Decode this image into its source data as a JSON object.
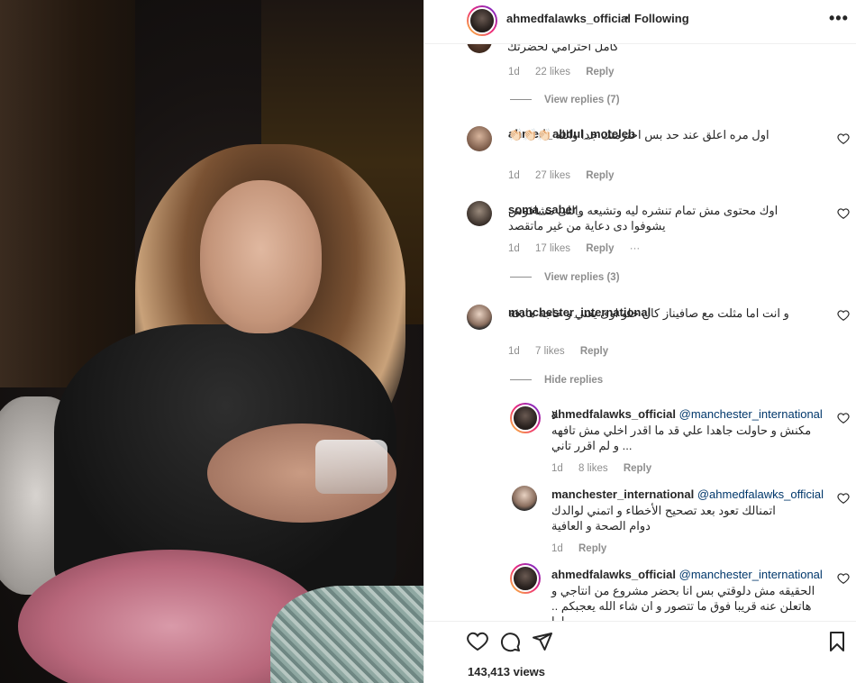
{
  "header": {
    "username": "ahmedfalawks_official",
    "separator": "•",
    "follow_status": "Following",
    "more": "•••"
  },
  "comments": [
    {
      "text": "كامل احترامي لحضرتك",
      "time": "1d",
      "likes": "22 likes",
      "reply": "Reply",
      "view_replies": "View replies (7)"
    },
    {
      "username": "ahmed_abdul_moteleb",
      "text": "اول مره اعلق عند حد بس احترمتك جدا والله 👏🏻👏🏻👏🏻",
      "time": "1d",
      "likes": "27 likes",
      "reply": "Reply"
    },
    {
      "username": "soma_saber_",
      "text": "اوك محتوى مش تمام تنشره ليه وتشيعه واللى مشافوش يشوفوا دى دعاية من غير ماتقصد",
      "time": "1d",
      "likes": "17 likes",
      "reply": "Reply",
      "more": "···",
      "view_replies": "View replies (3)"
    },
    {
      "username": "manchester_international",
      "text": "و انت اما مثلت مع صافيناز كان حلو اوى يعني و حاجة هادفة",
      "time": "1d",
      "likes": "7 likes",
      "reply": "Reply",
      "hide_replies": "Hide replies"
    }
  ],
  "replies": [
    {
      "username": "ahmedfalawks_official",
      "mention": "@manchester_international",
      "text_lead": "لا",
      "text": "مكنش و حاولت جاهدا علي قد ما اقدر اخلي مش تافهه ... و لم اقرر تاني",
      "time": "1d",
      "likes": "8 likes",
      "reply": "Reply"
    },
    {
      "username": "manchester_international",
      "mention": "@ahmedfalawks_official",
      "text": "اتمنالك تعود بعد تصحيح الأخطاء و اتمني لوالدك دوام الصحة و العافية",
      "time": "1d",
      "reply": "Reply"
    },
    {
      "username": "ahmedfalawks_official",
      "mention": "@manchester_international",
      "text": "الحقيقه مش دلوقتي بس انا بحضر مشروع من انتاجي و هاتعلن عنه قريبا فوق ما تتصور و ان شاء الله يعجبكم .. اما"
    }
  ],
  "footer": {
    "views": "143,413 views"
  },
  "icons": {
    "like": "heart-icon",
    "comment": "comment-icon",
    "share": "send-icon",
    "save": "bookmark-icon"
  }
}
